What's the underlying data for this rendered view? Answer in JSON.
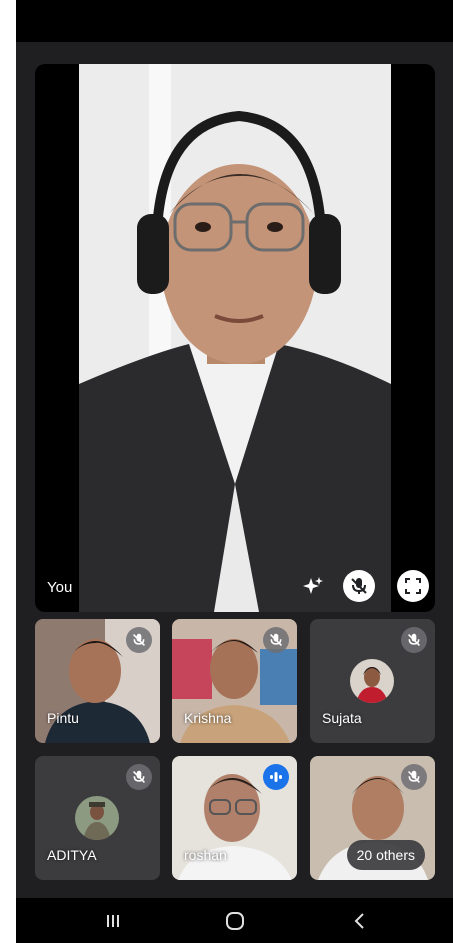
{
  "self_view": {
    "label": "You"
  },
  "participants": [
    {
      "name": "Pintu",
      "muted": true
    },
    {
      "name": "Krishna",
      "muted": true
    },
    {
      "name": "Sujata",
      "muted": true
    },
    {
      "name": "ADITYA",
      "muted": true
    },
    {
      "name": "roshan",
      "speaking": true
    },
    {
      "name": "",
      "muted": true
    }
  ],
  "overflow": {
    "label": "20 others"
  },
  "icons": {
    "effects": "sparkle-icon",
    "mute_self": "mic-off-icon",
    "fullscreen": "fullscreen-icon",
    "muted": "mic-off-icon",
    "speaking": "audio-wave-icon",
    "nav_recents": "recents-icon",
    "nav_home": "home-icon",
    "nav_back": "back-icon"
  },
  "colors": {
    "background": "#1f1f21",
    "tile": "#3c3c3f",
    "speaking": "#1a73e8"
  }
}
